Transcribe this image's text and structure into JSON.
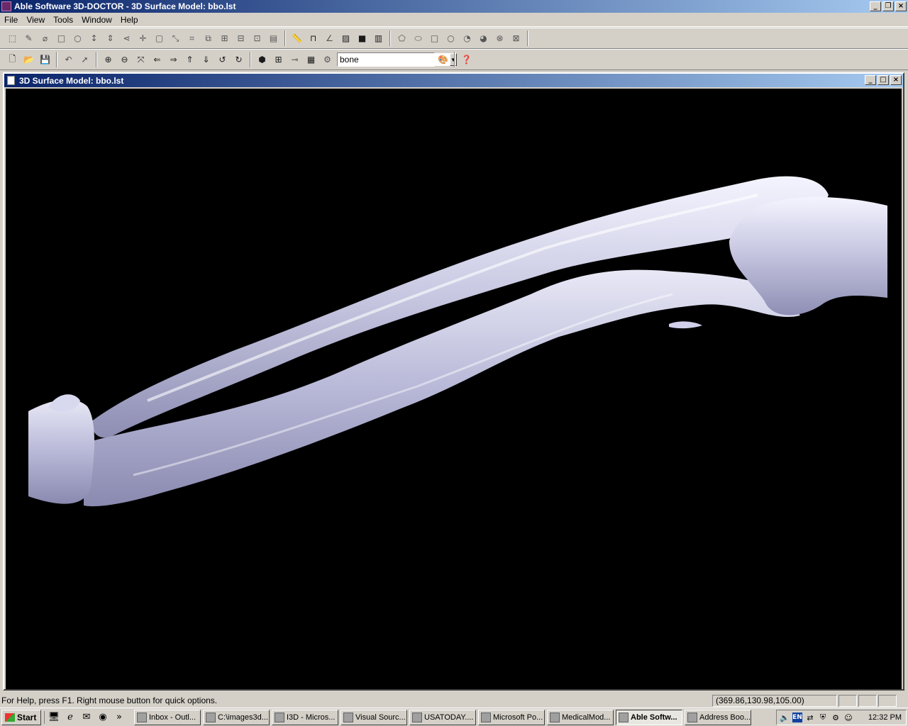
{
  "window": {
    "title": "Able Software 3D-DOCTOR - 3D Surface Model: bbo.lst",
    "min": "_",
    "max": "❐",
    "close": "×"
  },
  "menu": [
    "File",
    "View",
    "Tools",
    "Window",
    "Help"
  ],
  "toolbar": {
    "combo_value": "bone"
  },
  "document": {
    "title": "3D Surface Model: bbo.lst"
  },
  "status": {
    "help_text": "For Help, press F1. Right mouse button for quick options.",
    "coords": "(369.86,130.98,105.00)"
  },
  "taskbar": {
    "start": "Start",
    "chevron": "»",
    "tasks": [
      "Inbox - Outl...",
      "C:\\images3d...",
      "I3D - Micros...",
      "Visual Sourc...",
      "USATODAY....",
      "Microsoft Po...",
      "MedicalMod...",
      "Able Softw...",
      "Address Boo..."
    ],
    "lang": "EN",
    "clock": "12:32 PM"
  }
}
